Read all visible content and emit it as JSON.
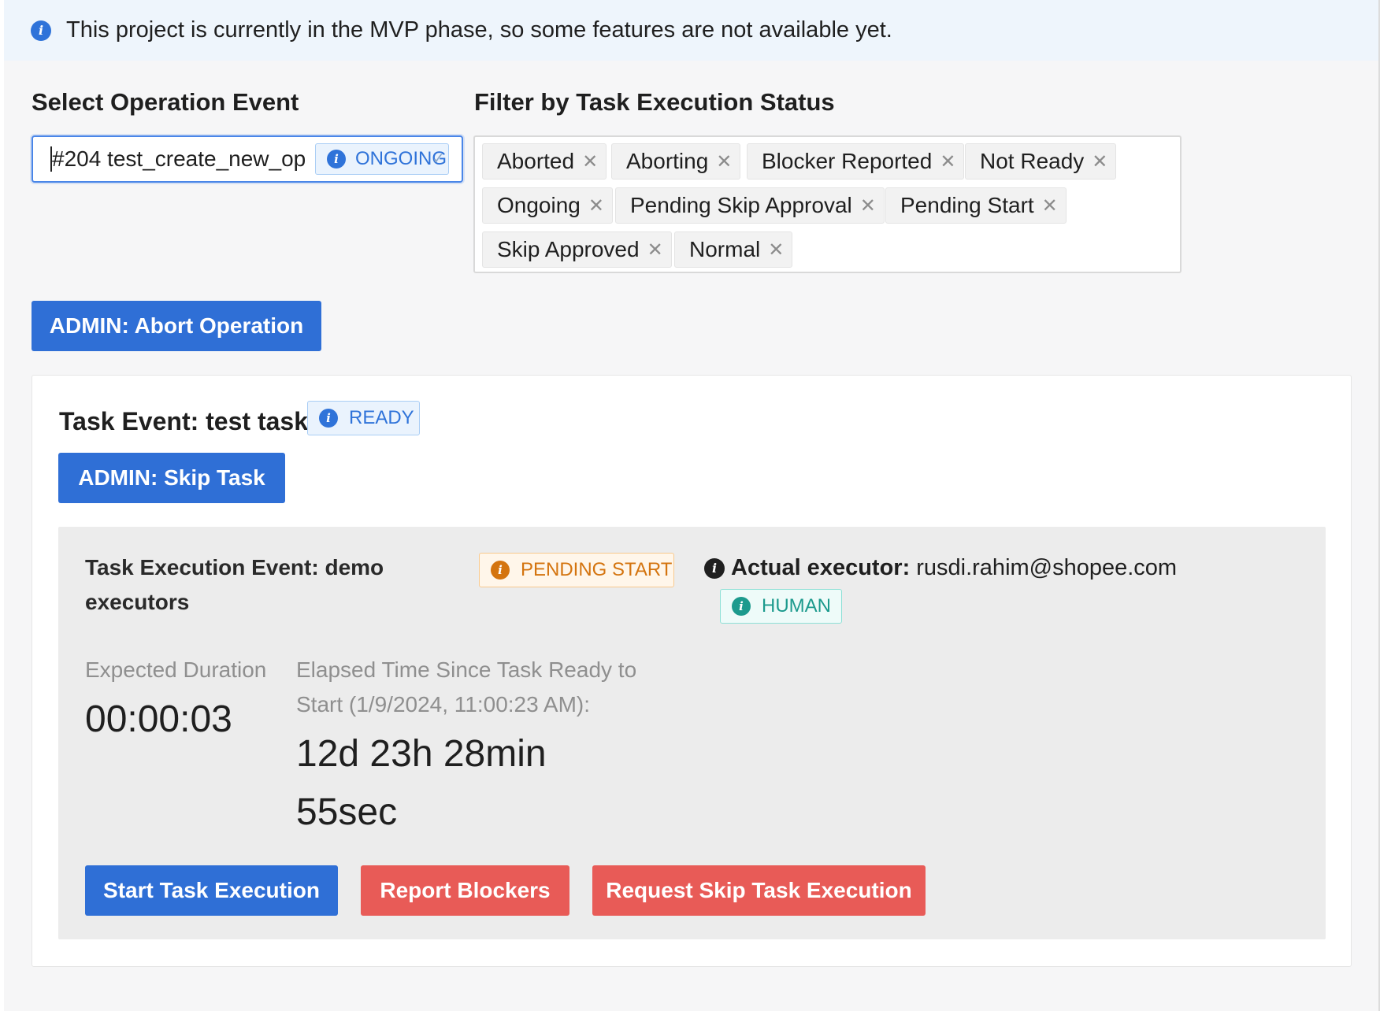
{
  "banner": {
    "icon": "info-icon",
    "text": "This project is currently in the MVP phase, so some features are not available yet."
  },
  "operation_select": {
    "label": "Select Operation Event",
    "value": "#204 test_create_new_op",
    "status_tag": "ONGOING"
  },
  "status_filter": {
    "label": "Filter by Task Execution Status",
    "chips": [
      "Aborted",
      "Aborting",
      "Blocker Reported",
      "Not Ready",
      "Ongoing",
      "Pending Skip Approval",
      "Pending Start",
      "Skip Approved",
      "Normal"
    ]
  },
  "actions": {
    "abort_operation": "ADMIN: Abort Operation"
  },
  "task_event": {
    "title": "Task Event: test task",
    "status_tag": "READY",
    "skip_button": "ADMIN: Skip Task",
    "execution": {
      "title": "Task Execution Event: demo executors",
      "status_tag": "PENDING START",
      "executor_label": "Actual executor:",
      "executor_value": "rusdi.rahim@shopee.com",
      "executor_type_tag": "HUMAN",
      "expected_duration_label": "Expected Duration",
      "expected_duration_value": "00:00:03",
      "elapsed_label": "Elapsed Time Since Task Ready to Start (1/9/2024, 11:00:23 AM):",
      "elapsed_value": "12d 23h 28min 55sec",
      "buttons": {
        "start": "Start Task Execution",
        "report": "Report Blockers",
        "request_skip": "Request Skip Task Execution"
      }
    }
  },
  "colors": {
    "primary": "#2f6fd6",
    "danger": "#e85b57",
    "info": "#2f73d9",
    "warning": "#d4740f",
    "success": "#1c9a8d"
  }
}
